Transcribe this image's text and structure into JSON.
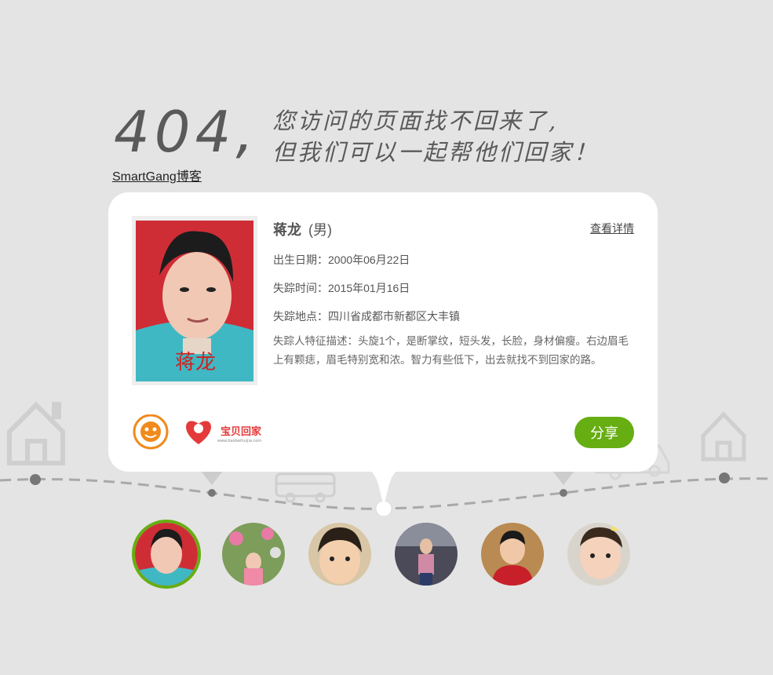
{
  "header": {
    "code": "404,",
    "line1": "您访问的页面找不回来了,",
    "line2": "但我们可以一起帮他们回家！",
    "blog_link": "SmartGang博客"
  },
  "card": {
    "name": "蒋龙",
    "gender": "(男)",
    "detail_link": "查看详情",
    "birth_label": "出生日期：",
    "birth_value": "2000年06月22日",
    "missing_time_label": "失踪时间：",
    "missing_time_value": "2015年01月16日",
    "missing_place_label": "失踪地点：",
    "missing_place_value": "四川省成都市新都区大丰镇",
    "features_label": "失踪人特征描述：",
    "features_value": "头旋1个，是断掌纹，短头发，长脸，身材偏瘦。右边眉毛上有颗痣，眉毛特别宽和浓。智力有些低下，出去就找不到回家的路。",
    "photo_caption": "蒋龙",
    "share_button": "分享",
    "logo_right_text": "宝贝回家",
    "logo_right_url": "www.baobeihuijia.com"
  },
  "colors": {
    "accent": "#66ae12",
    "background": "#e4e4e4",
    "text": "#555555"
  },
  "avatars": [
    {
      "name": "avatar-1",
      "active": true
    },
    {
      "name": "avatar-2",
      "active": false
    },
    {
      "name": "avatar-3",
      "active": false
    },
    {
      "name": "avatar-4",
      "active": false
    },
    {
      "name": "avatar-5",
      "active": false
    },
    {
      "name": "avatar-6",
      "active": false
    }
  ]
}
